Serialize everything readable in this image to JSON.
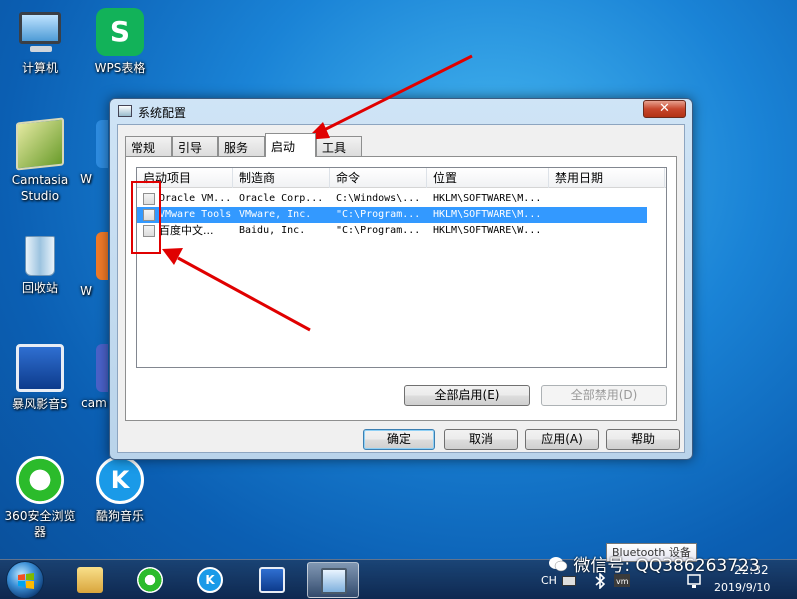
{
  "desktop": {
    "icons": [
      {
        "label": "计算机"
      },
      {
        "label": "WPS表格"
      },
      {
        "label": "Camtasia Studio"
      },
      {
        "label": "回收站"
      },
      {
        "label": "暴风影音5"
      },
      {
        "label": "360安全浏览器"
      },
      {
        "label": "酷狗音乐"
      }
    ],
    "partial_labels": [
      "W",
      "W",
      "W",
      "cam"
    ]
  },
  "dialog": {
    "title": "系统配置",
    "close_label": "✕",
    "tabs": [
      "常规",
      "引导",
      "服务",
      "启动",
      "工具"
    ],
    "active_tab": "启动",
    "columns": [
      "启动项目",
      "制造商",
      "命令",
      "位置",
      "禁用日期"
    ],
    "rows": [
      {
        "item": "Oracle VM...",
        "maker": "Oracle Corp...",
        "command": "C:\\Windows\\...",
        "location": "HKLM\\SOFTWARE\\M...",
        "date": "",
        "checked": false,
        "selected": false
      },
      {
        "item": "VMware Tools",
        "maker": "VMware, Inc.",
        "command": "\"C:\\Program...",
        "location": "HKLM\\SOFTWARE\\M...",
        "date": "",
        "checked": false,
        "selected": true
      },
      {
        "item": "百度中文...",
        "maker": "Baidu, Inc.",
        "command": "\"C:\\Program...",
        "location": "HKLM\\SOFTWARE\\W...",
        "date": "",
        "checked": false,
        "selected": false
      }
    ],
    "enable_all": "全部启用(E)",
    "disable_all": "全部禁用(D)",
    "ok": "确定",
    "cancel": "取消",
    "apply": "应用(A)",
    "help": "帮助"
  },
  "taskbar": {
    "tooltip": "Bluetooth 设备",
    "lang": "CH",
    "time": "22:32",
    "date": "2019/9/10"
  },
  "watermark": "微信号: QQ386263723",
  "colors": {
    "selection": "#3399ff",
    "annotation": "#e00000",
    "wps": "#12b259"
  }
}
